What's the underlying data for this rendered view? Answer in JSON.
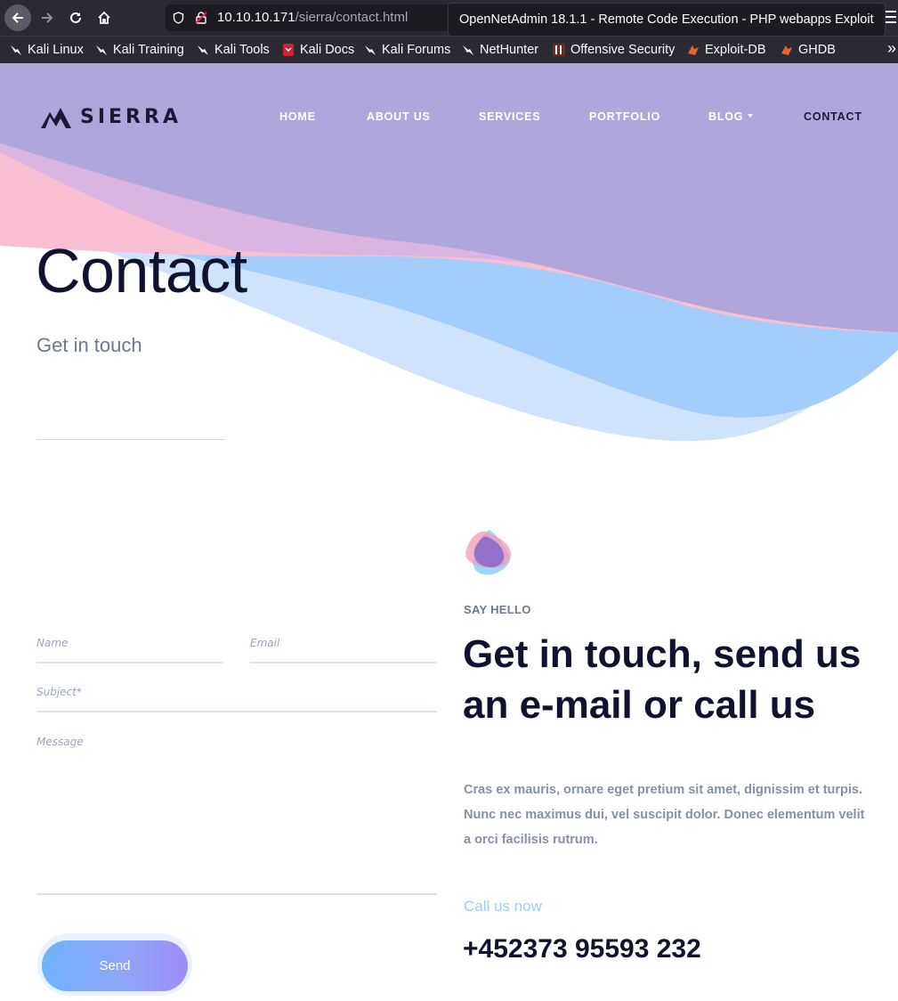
{
  "browser": {
    "url_host": "10.10.10.171",
    "url_path": "/sierra/contact.html",
    "tooltip": "OpenNetAdmin 18.1.1 - Remote Code Execution - PHP webapps Exploit",
    "bookmarks": [
      {
        "label": "Kali Linux",
        "icon": "kali-dragon-icon"
      },
      {
        "label": "Kali Training",
        "icon": "kali-dragon-icon"
      },
      {
        "label": "Kali Tools",
        "icon": "kali-dragon-icon"
      },
      {
        "label": "Kali Docs",
        "icon": "kali-docs-icon"
      },
      {
        "label": "Kali Forums",
        "icon": "kali-dragon-icon"
      },
      {
        "label": "NetHunter",
        "icon": "kali-dragon-icon"
      },
      {
        "label": "Offensive Security",
        "icon": "offsec-icon"
      },
      {
        "label": "Exploit-DB",
        "icon": "exploit-db-icon"
      },
      {
        "label": "GHDB",
        "icon": "exploit-db-icon"
      }
    ]
  },
  "site": {
    "logo": "SIERRA",
    "nav": {
      "home": "HOME",
      "about": "ABOUT US",
      "services": "SERVICES",
      "portfolio": "PORTFOLIO",
      "blog": "BLOG",
      "contact": "CONTACT"
    },
    "active_nav": "contact"
  },
  "hero": {
    "title": "Contact",
    "subtitle": "Get in touch"
  },
  "form": {
    "name_placeholder": "Name",
    "email_placeholder": "Email",
    "subject_placeholder": "Subject*",
    "message_placeholder": "Message",
    "send_label": "Send"
  },
  "info": {
    "kicker": "SAY HELLO",
    "title": "Get in touch, send us an e-mail or call us",
    "text": "Cras ex mauris, ornare eget pretium sit amet, dignissim et turpis. Nunc nec maximus dui, vel suscipit dolor. Donec elementum velit a orci facilisis rutrum.",
    "call_label": "Call us now",
    "phone": "+452373 95593 232"
  },
  "colors": {
    "wave_purple": "#afa7db",
    "wave_pink": "#f3b9d1",
    "wave_blue": "#a3cefb",
    "text_dark": "#0f1330",
    "accent_blue": "#9fcdf6"
  }
}
